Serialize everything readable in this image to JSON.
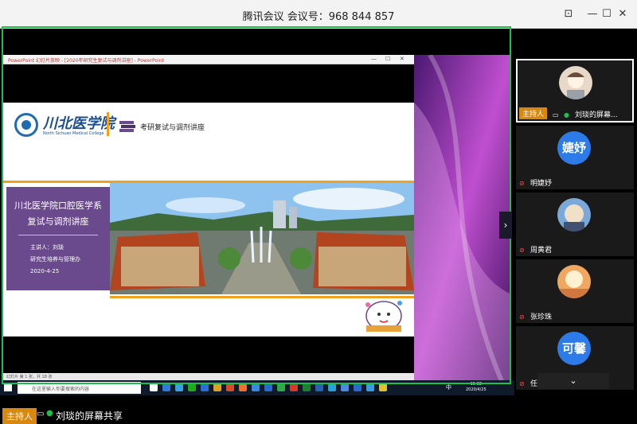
{
  "window": {
    "title": "腾讯会议 会议号：968 844 857",
    "minimize_icon": "minimize-icon",
    "maximize_icon": "maximize-icon",
    "close_icon": "close-icon"
  },
  "ppt": {
    "window_title": "PowerPoint 幻灯片放映 - [2020年研究生复试与调剂讲座] - PowerPoint",
    "status": "幻灯片 第 1 张，共 18 张",
    "slide": {
      "logo_cn": "川北医学院",
      "logo_en": "North Sichuan Medical College",
      "header_title": "考研复试与调剂讲座",
      "main_title_line1": "川北医学院口腔医学系",
      "main_title_line2": "复试与调剂讲座",
      "speaker": "主讲人：刘琰",
      "department": "研究生培养与管理办",
      "date": "2020-4-25"
    }
  },
  "taskbar": {
    "search_placeholder": "在这里输入你要搜索的内容",
    "time": "15:32",
    "date": "2020/4/25",
    "ime": "中"
  },
  "participants": [
    {
      "name": "刘琰的屏幕...",
      "host": true,
      "host_label": "主持人",
      "avatar_type": "image"
    },
    {
      "name": "明婕妤",
      "avatar_text": "婕妤",
      "avatar_type": "text"
    },
    {
      "name": "周黄君",
      "avatar_type": "image"
    },
    {
      "name": "张珍珠",
      "avatar_type": "image"
    },
    {
      "name": "任可馨",
      "avatar_text": "可馨",
      "avatar_type": "text"
    }
  ],
  "bottom": {
    "host_label": "主持人",
    "share_text": "刘琰的屏幕共享"
  },
  "colors": {
    "accent_orange": "#d9880f",
    "share_green": "#1dbf4a",
    "avatar_blue": "#2d7be8",
    "slide_purple": "#6a4a8d"
  }
}
